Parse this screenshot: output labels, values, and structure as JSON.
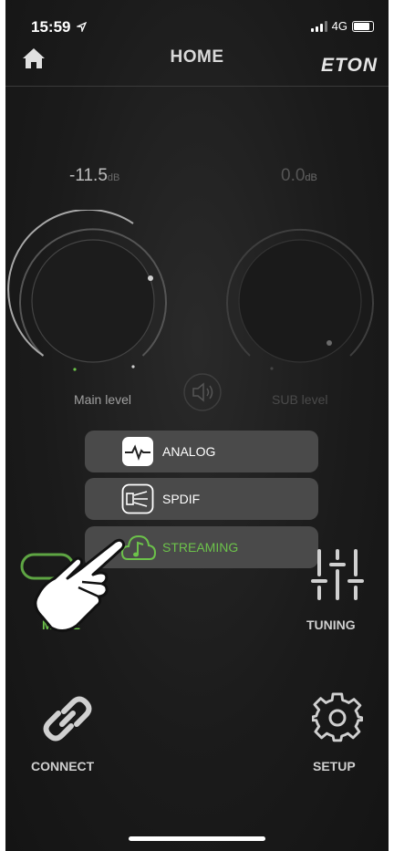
{
  "status_bar": {
    "time": "15:59",
    "network": "4G"
  },
  "header": {
    "title": "HOME",
    "brand": "ETON"
  },
  "levels": {
    "main": {
      "value": "-11.5",
      "unit": "dB",
      "label": "Main level"
    },
    "sub": {
      "value": "0.0",
      "unit": "dB",
      "label": "SUB level"
    }
  },
  "source_menu": {
    "items": [
      {
        "label": "ANALOG",
        "icon": "analog-waveform-icon"
      },
      {
        "label": "SPDIF",
        "icon": "spdif-optical-icon"
      },
      {
        "label": "STREAMING",
        "icon": "streaming-cloud-music-icon",
        "selected": true
      }
    ]
  },
  "bottom_nav": {
    "mode": "MODE",
    "tuning": "TUNING",
    "connect": "CONNECT",
    "setup": "SETUP"
  },
  "colors": {
    "background": "#1b1b1b",
    "accent_green": "#6cc24a",
    "menu_item": "#4a4a4a",
    "text_light": "#cfcfcf"
  }
}
